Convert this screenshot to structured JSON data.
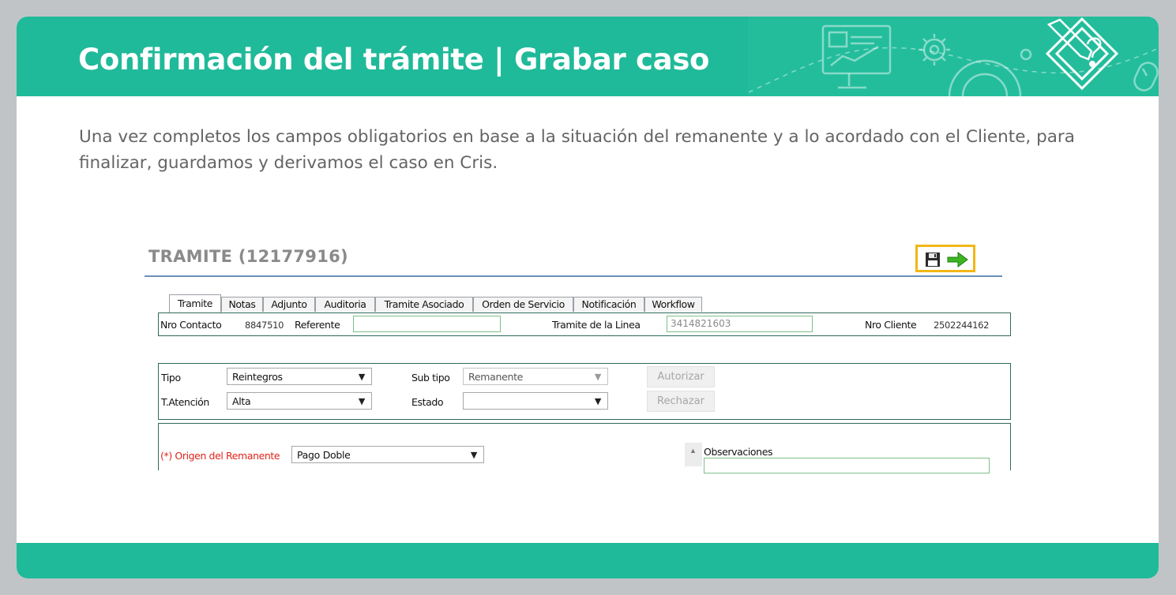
{
  "header": {
    "title": "Confirmación del trámite | Grabar caso",
    "background": "#1fba99"
  },
  "intro_text": "Una vez completos los campos obligatorios en base a la situación del remanente y a lo acordado con el Cliente, para finalizar, guardamos  y derivamos el caso en Cris.",
  "icons": [
    "monitor-chart-icon",
    "gear-icon",
    "mouse-icon",
    "pencil-question-diamond-icon",
    "save-icon",
    "arrow-right-icon"
  ],
  "app": {
    "title": "TRAMITE (12177916)",
    "highlight_color": "#f2b616",
    "tabs": [
      "Tramite",
      "Notas",
      "Adjunto",
      "Auditoria",
      "Tramite Asociado",
      "Orden de Servicio",
      "Notificación",
      "Workflow"
    ],
    "active_tab": "Tramite",
    "contact": {
      "nro_contacto_label": "Nro Contacto",
      "nro_contacto_value": "8847510",
      "referente_label": "Referente",
      "referente_value": "",
      "tramite_linea_label": "Tramite de la Linea",
      "tramite_linea_value": "3414821603",
      "nro_cliente_label": "Nro Cliente",
      "nro_cliente_value": "2502244162"
    },
    "form": {
      "tipo_label": "Tipo",
      "tipo_value": "Reintegros",
      "subtipo_label": "Sub tipo",
      "subtipo_value": "Remanente",
      "atencion_label": "T.Atención",
      "atencion_value": "Alta",
      "estado_label": "Estado",
      "estado_value": "",
      "autorizar_label": "Autorizar",
      "rechazar_label": "Rechazar"
    },
    "detail": {
      "origen_required": "(*)",
      "origen_label": "Origen del Remanente",
      "origen_value": "Pago Doble",
      "observaciones_label": "Observaciones"
    }
  }
}
